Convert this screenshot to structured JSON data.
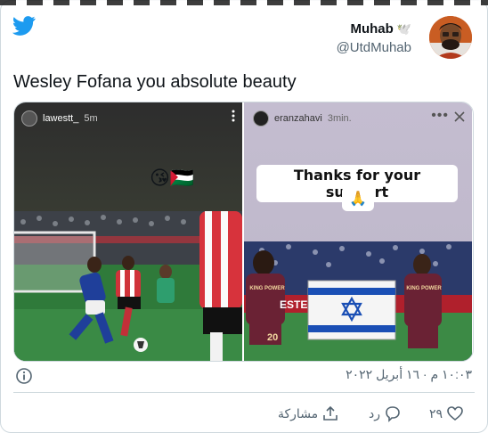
{
  "tweet": {
    "author_name": "Muhab",
    "author_name_emoji": "🕊️",
    "author_handle": "@UtdMuhab",
    "text": "Wesley Fofana you absolute beauty",
    "timestamp": "١٠:٠٣ م · ١٦ أبريل ٢٠٢٢",
    "like_count": "٢٩",
    "reply_label": "رد",
    "share_label": "مشاركة"
  },
  "media": {
    "left": {
      "story_user": "lawestt_",
      "story_time": "5m",
      "emoji": "😘🇵🇸"
    },
    "right": {
      "story_user": "eranzahavi",
      "story_time": "3min.",
      "caption": "Thanks for your support",
      "caption_emoji": "🙏",
      "banner_text": "ESTE",
      "jersey_sponsor": "KING POWER",
      "jersey_number": "20"
    }
  },
  "colors": {
    "twitter_blue": "#1d9bf0",
    "text_primary": "#0f1419",
    "text_secondary": "#536471",
    "border": "#cfd9de"
  },
  "icons": {
    "logo": "twitter-bird-icon",
    "info": "info-icon",
    "like": "heart-icon",
    "reply": "reply-bubble-icon",
    "share": "share-icon",
    "story_menu": "more-dots-icon",
    "story_close": "close-icon"
  }
}
